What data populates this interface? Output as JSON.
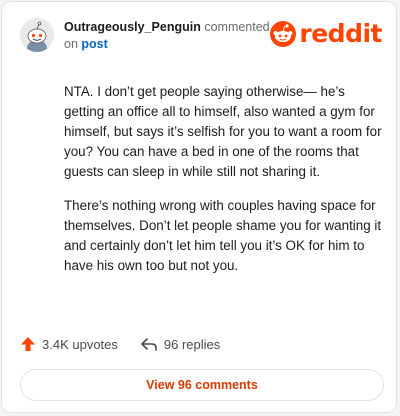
{
  "comment": {
    "author": "Outrageously_Penguin",
    "verb": "commented",
    "preposition": "on",
    "post_link": "post",
    "paragraphs": [
      "NTA. I don’t get people saying otherwise— he’s getting an office all to himself, also wanted a gym for himself, but says it’s selfish for you to want a room for you? You can have a bed in one of the rooms that guests can sleep in while still not sharing it.",
      "There’s nothing wrong with couples having space for themselves. Don’t let people shame you for wanting it and certainly don’t let him tell you it’s OK for him to have his own too but not you."
    ]
  },
  "brand": {
    "wordmark": "reddit",
    "color": "#ff4500",
    "icon": "reddit-snoo-icon"
  },
  "actions": {
    "upvotes": "3.4K upvotes",
    "replies": "96 replies",
    "upvote_icon": "upvote-arrow-icon",
    "reply_icon": "reply-arrow-icon",
    "upvote_color": "#ff4500"
  },
  "footer": {
    "view_label": "View 96 comments",
    "link_color": "#d93a00"
  }
}
